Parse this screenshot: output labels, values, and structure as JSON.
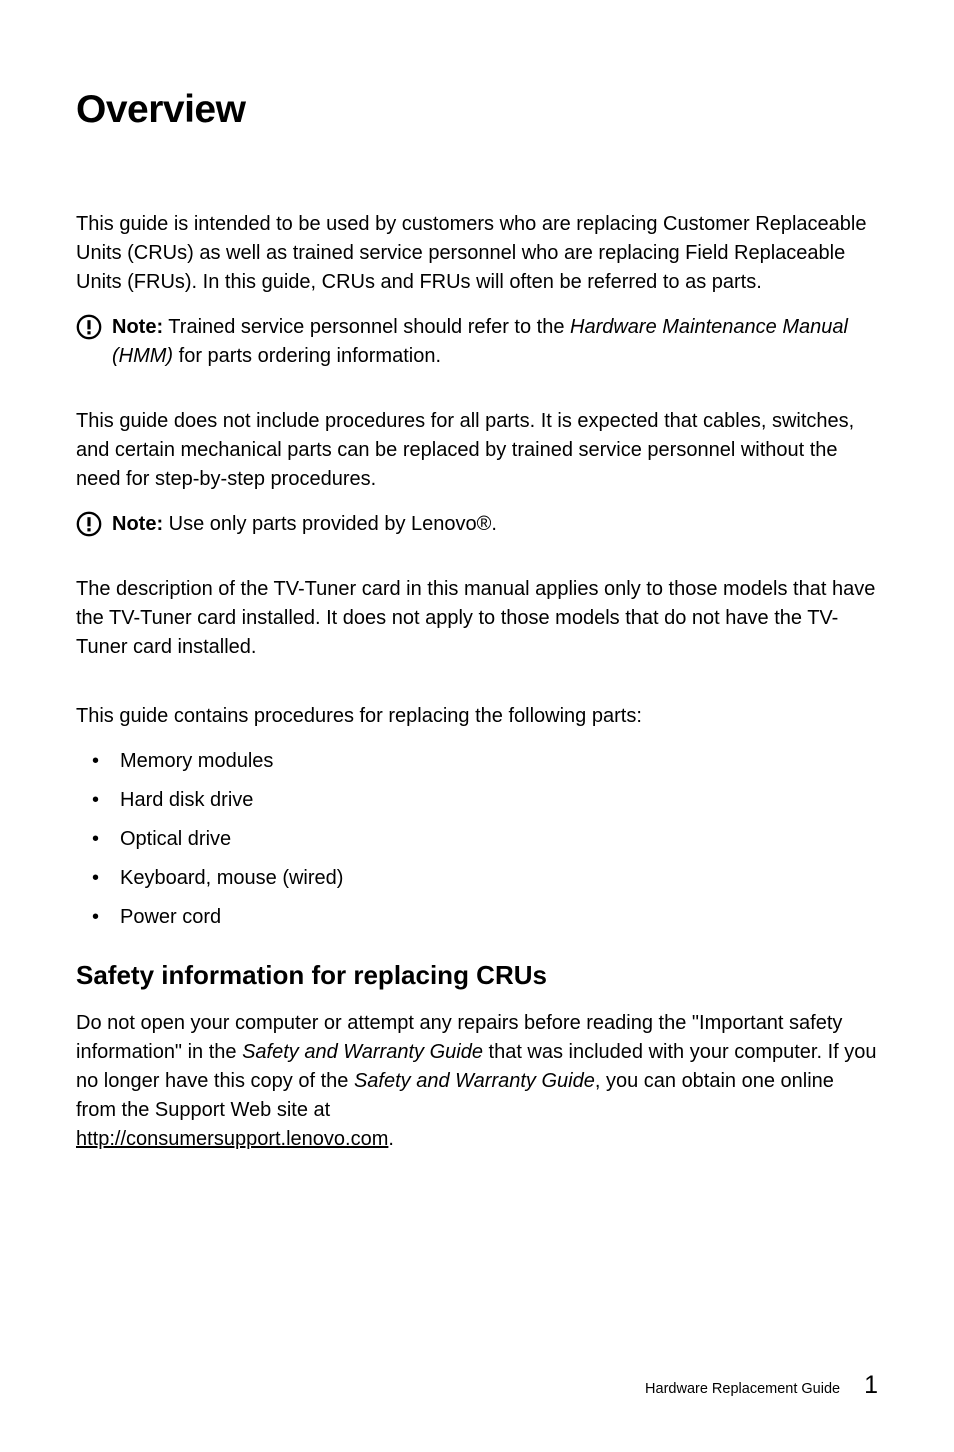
{
  "heading": "Overview",
  "para1": "This guide is intended to be used by customers who are replacing Customer Replaceable Units (CRUs) as well as trained service personnel who are replacing Field Replaceable Units (FRUs). In this guide, CRUs and FRUs will often be referred to as parts.",
  "note1": {
    "label": "Note:",
    "before_italic": " Trained service personnel should refer to the ",
    "italic": "Hardware Maintenance Manual (HMM)",
    "after_italic": " for parts ordering information."
  },
  "para2": "This guide does not include procedures for all parts. It is expected that cables, switches, and certain mechanical parts can be replaced by trained service personnel without the need for step-by-step procedures.",
  "note2": {
    "label": "Note:",
    "text": " Use only parts provided by Lenovo®."
  },
  "para3": "The description of the TV-Tuner card in this manual applies only to those models that have the TV-Tuner card installed. It does not apply to those models that do not have the TV-Tuner card installed.",
  "para4": "This guide contains procedures for replacing the following parts:",
  "list": [
    "Memory modules",
    "Hard disk drive",
    "Optical drive",
    "Keyboard, mouse (wired)",
    "Power cord"
  ],
  "safety_heading": "Safety information for replacing CRUs",
  "safety_para": {
    "t1": "Do not open your computer or attempt any repairs before reading the \"Important safety information\" in the ",
    "i1": "Safety and Warranty Guide",
    "t2": " that was included with your computer. If you no longer have this copy of the ",
    "i2": "Safety and Warranty Guide",
    "t3": ", you can obtain one online from the Support Web site at ",
    "link": "http://consumersupport.lenovo.com",
    "t4": "."
  },
  "footer": {
    "text": "Hardware Replacement Guide",
    "page": "1"
  }
}
